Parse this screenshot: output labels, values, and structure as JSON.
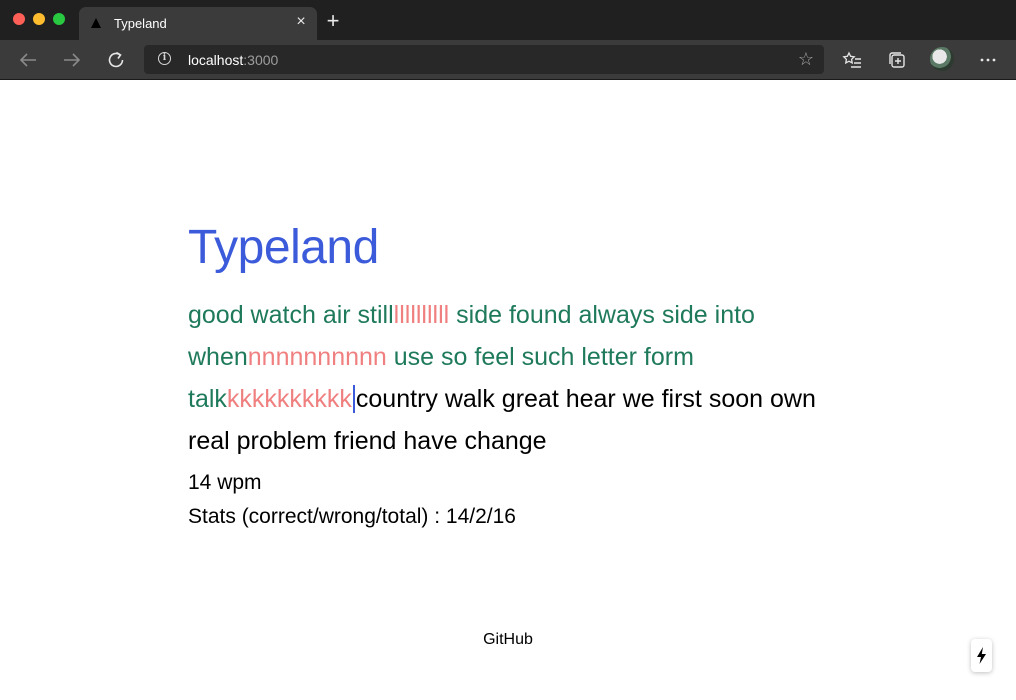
{
  "browser": {
    "tab": {
      "title": "Typeland",
      "close_glyph": "×"
    },
    "new_tab_glyph": "+",
    "url": {
      "host": "localhost",
      "port": ":3000"
    },
    "icons": {
      "back": "arrow-left-icon",
      "forward": "arrow-right-icon",
      "reload": "reload-icon",
      "info": "info-icon",
      "favorite": "star-icon",
      "favorites": "favorites-list-icon",
      "collections": "collections-icon",
      "profile": "avatar",
      "more": "more-icon"
    }
  },
  "app": {
    "title": "Typeland",
    "colors": {
      "title": "#3b5bdb",
      "correct": "#1e7a5a",
      "extra": "#f08080",
      "pending": "#000000",
      "caret": "#3b5bdb"
    },
    "words": {
      "line1": {
        "w1": "good watch air still",
        "x1": "llllllllll",
        "w2": "side found always side into"
      },
      "line2": {
        "w1": "when",
        "x1": "nnnnnnnnnn",
        "w2": "use so feel such letter form"
      },
      "line3": {
        "w1": "talk",
        "x1": "kkkkkkkkkk",
        "pending": "country walk great hear we first soon"
      },
      "line4": {
        "pending": "own real problem friend have change"
      }
    },
    "wpm": "14 wpm",
    "stats": "Stats (correct/wrong/total) : 14/2/16",
    "footer_link": "GitHub"
  }
}
